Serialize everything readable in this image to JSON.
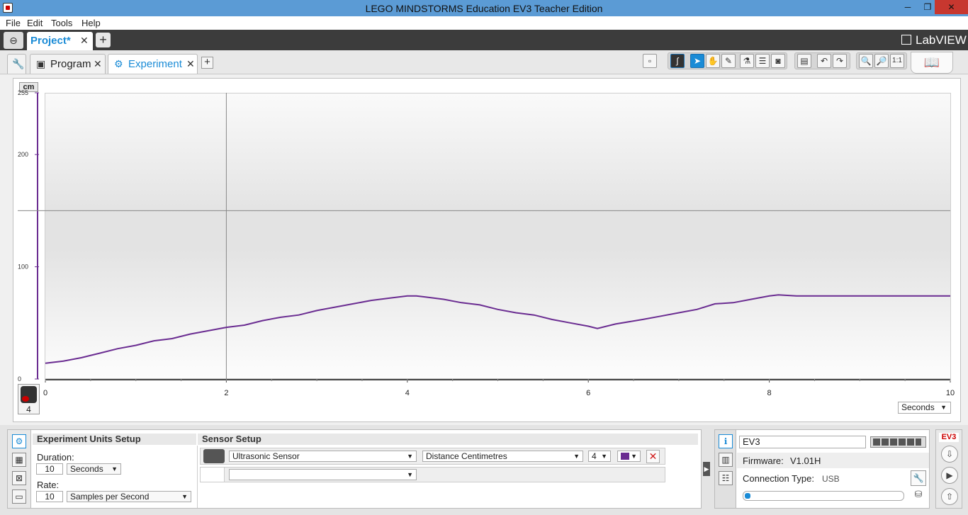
{
  "window": {
    "title": "LEGO MINDSTORMS Education EV3 Teacher Edition",
    "minimize": "─",
    "maximize": "❐",
    "close": "✕"
  },
  "menu": [
    "File",
    "Edit",
    "Tools",
    "Help"
  ],
  "project": {
    "tab_label": "Project*",
    "close": "✕",
    "add": "+",
    "brand": "LabVIEW"
  },
  "tabs": {
    "program": "Program",
    "experiment": "Experiment",
    "close": "✕",
    "add": "+"
  },
  "chart_data": {
    "type": "line",
    "ylabel": "cm",
    "ylim": [
      0,
      255
    ],
    "yticks": [
      0,
      100,
      200,
      255
    ],
    "xlim": [
      0,
      10
    ],
    "xticks": [
      0,
      2,
      4,
      6,
      8,
      10
    ],
    "x_unit": "Seconds",
    "color": "#6a2c91",
    "cursor_x": 2,
    "cursor_y": 150,
    "x": [
      0,
      0.2,
      0.4,
      0.6,
      0.8,
      1.0,
      1.2,
      1.4,
      1.6,
      1.8,
      2.0,
      2.2,
      2.4,
      2.6,
      2.8,
      3.0,
      3.2,
      3.4,
      3.6,
      3.8,
      4.0,
      4.1,
      4.2,
      4.4,
      4.6,
      4.8,
      5.0,
      5.2,
      5.4,
      5.6,
      5.8,
      6.0,
      6.1,
      6.3,
      6.6,
      6.8,
      7.0,
      7.2,
      7.4,
      7.6,
      7.8,
      8.0,
      8.1,
      8.3,
      8.6,
      9.0,
      9.4,
      9.8,
      10.0
    ],
    "values": [
      14,
      16,
      19,
      23,
      27,
      30,
      34,
      36,
      40,
      43,
      46,
      48,
      52,
      55,
      57,
      61,
      64,
      67,
      70,
      72,
      74,
      74,
      73,
      71,
      68,
      66,
      62,
      59,
      57,
      53,
      50,
      47,
      45,
      49,
      53,
      56,
      59,
      62,
      67,
      68,
      71,
      74,
      75,
      74,
      74,
      74,
      74,
      74,
      74
    ],
    "sensor_port": "4"
  },
  "setup": {
    "units_header": "Experiment Units Setup",
    "sensor_header": "Sensor Setup",
    "duration_label": "Duration:",
    "duration_value": "10",
    "duration_unit": "Seconds",
    "rate_label": "Rate:",
    "rate_value": "10",
    "rate_unit": "Samples per Second",
    "sensor_type": "Ultrasonic Sensor",
    "sensor_mode": "Distance Centimetres",
    "sensor_port": "4",
    "sensor_color": "#6a2c91",
    "empty_sensor": ""
  },
  "brick": {
    "name": "EV3",
    "firmware_label": "Firmware:",
    "firmware_value": "V1.01H",
    "connection_label": "Connection Type:",
    "connection_value": "USB",
    "brand": "EV3"
  }
}
